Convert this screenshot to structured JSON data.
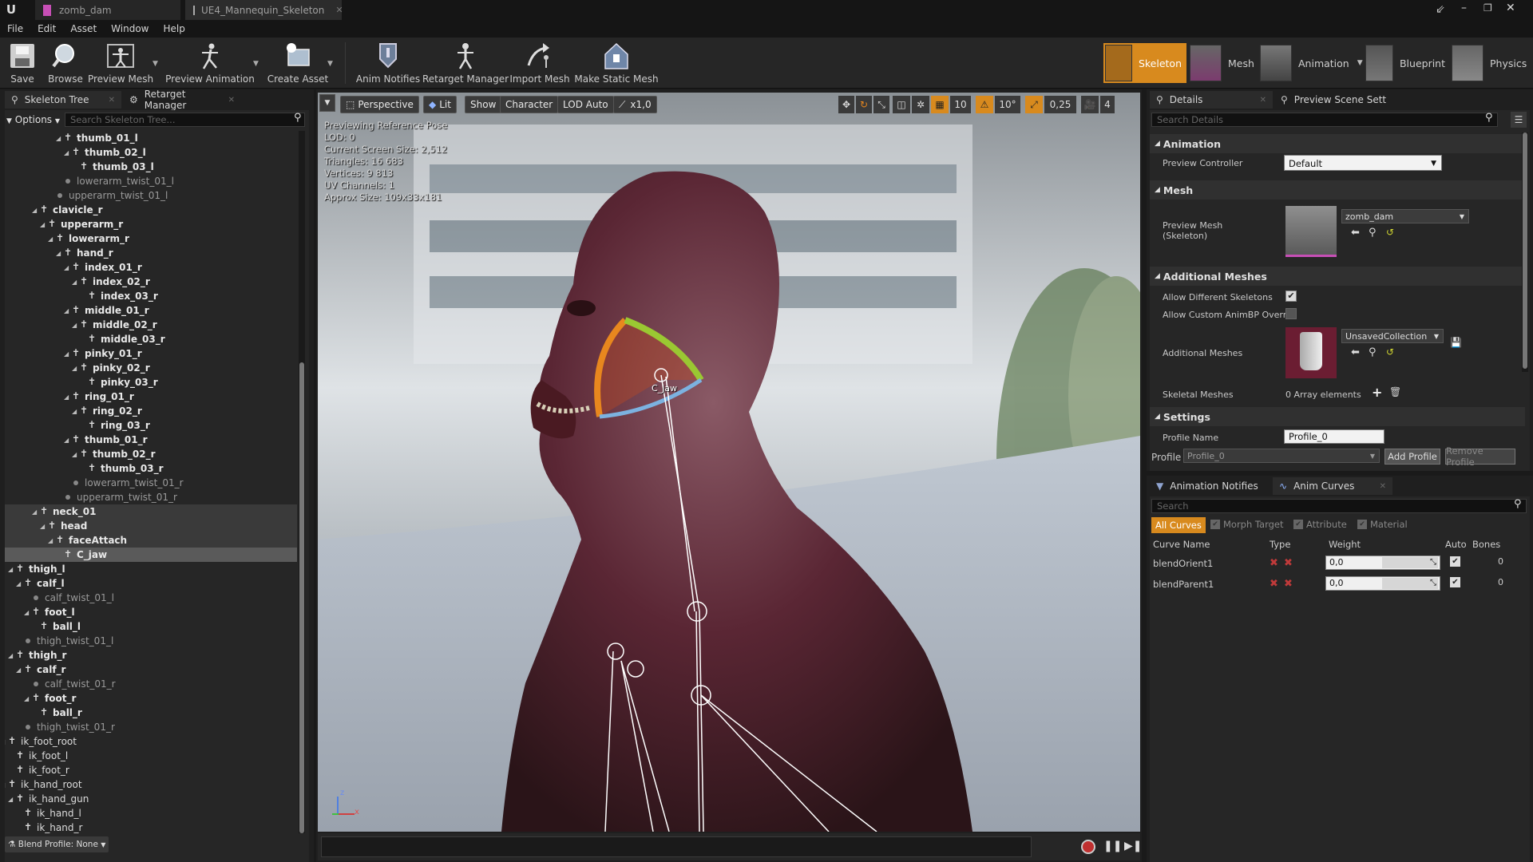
{
  "window": {
    "tabs": [
      {
        "label": "zomb_dam"
      },
      {
        "label": "UE4_Mannequin_Skeleton"
      }
    ]
  },
  "menu": [
    "File",
    "Edit",
    "Asset",
    "Window",
    "Help"
  ],
  "toolbar": {
    "buttons": [
      {
        "label": "Save"
      },
      {
        "label": "Browse"
      },
      {
        "label": "Preview Mesh"
      },
      {
        "label": "Preview Animation"
      },
      {
        "label": "Create Asset"
      },
      {
        "label": "Anim Notifies"
      },
      {
        "label": "Retarget Manager"
      },
      {
        "label": "Import Mesh"
      },
      {
        "label": "Make Static Mesh"
      }
    ],
    "modes": [
      {
        "label": "Skeleton",
        "active": true
      },
      {
        "label": "Mesh"
      },
      {
        "label": "Animation"
      },
      {
        "label": "Blueprint"
      },
      {
        "label": "Physics"
      }
    ]
  },
  "left_panel": {
    "tabs": [
      "Skeleton Tree",
      "Retarget Manager"
    ],
    "options_label": "Options",
    "search_placeholder": "Search Skeleton Tree...",
    "blend_profile": "Blend Profile: None",
    "tree": [
      {
        "name": "thumb_01_l",
        "depth": 9,
        "type": "bone",
        "exp": true
      },
      {
        "name": "thumb_02_l",
        "depth": 10,
        "type": "bone",
        "exp": true
      },
      {
        "name": "thumb_03_l",
        "depth": 11,
        "type": "bone"
      },
      {
        "name": "lowerarm_twist_01_l",
        "depth": 9,
        "type": "virtual"
      },
      {
        "name": "upperarm_twist_01_l",
        "depth": 8,
        "type": "virtual"
      },
      {
        "name": "clavicle_r",
        "depth": 6,
        "type": "bone",
        "exp": true
      },
      {
        "name": "upperarm_r",
        "depth": 7,
        "type": "bone",
        "exp": true
      },
      {
        "name": "lowerarm_r",
        "depth": 8,
        "type": "bone",
        "exp": true
      },
      {
        "name": "hand_r",
        "depth": 9,
        "type": "bone",
        "exp": true
      },
      {
        "name": "index_01_r",
        "depth": 10,
        "type": "bone",
        "exp": true
      },
      {
        "name": "index_02_r",
        "depth": 11,
        "type": "bone",
        "exp": true
      },
      {
        "name": "index_03_r",
        "depth": 12,
        "type": "bone"
      },
      {
        "name": "middle_01_r",
        "depth": 10,
        "type": "bone",
        "exp": true
      },
      {
        "name": "middle_02_r",
        "depth": 11,
        "type": "bone",
        "exp": true
      },
      {
        "name": "middle_03_r",
        "depth": 12,
        "type": "bone"
      },
      {
        "name": "pinky_01_r",
        "depth": 10,
        "type": "bone",
        "exp": true
      },
      {
        "name": "pinky_02_r",
        "depth": 11,
        "type": "bone",
        "exp": true
      },
      {
        "name": "pinky_03_r",
        "depth": 12,
        "type": "bone"
      },
      {
        "name": "ring_01_r",
        "depth": 10,
        "type": "bone",
        "exp": true
      },
      {
        "name": "ring_02_r",
        "depth": 11,
        "type": "bone",
        "exp": true
      },
      {
        "name": "ring_03_r",
        "depth": 12,
        "type": "bone"
      },
      {
        "name": "thumb_01_r",
        "depth": 10,
        "type": "bone",
        "exp": true
      },
      {
        "name": "thumb_02_r",
        "depth": 11,
        "type": "bone",
        "exp": true
      },
      {
        "name": "thumb_03_r",
        "depth": 12,
        "type": "bone"
      },
      {
        "name": "lowerarm_twist_01_r",
        "depth": 10,
        "type": "virtual"
      },
      {
        "name": "upperarm_twist_01_r",
        "depth": 9,
        "type": "virtual"
      },
      {
        "name": "neck_01",
        "depth": 6,
        "type": "bone",
        "exp": true,
        "hl": true
      },
      {
        "name": "head",
        "depth": 7,
        "type": "bone",
        "exp": true,
        "hl": true
      },
      {
        "name": "faceAttach",
        "depth": 8,
        "type": "bone",
        "exp": true,
        "hl": true
      },
      {
        "name": "C_jaw",
        "depth": 9,
        "type": "bone",
        "sel": true
      },
      {
        "name": "thigh_l",
        "depth": 3,
        "type": "bone",
        "exp": true
      },
      {
        "name": "calf_l",
        "depth": 4,
        "type": "bone",
        "exp": true
      },
      {
        "name": "calf_twist_01_l",
        "depth": 5,
        "type": "virtual"
      },
      {
        "name": "foot_l",
        "depth": 5,
        "type": "bone",
        "exp": true
      },
      {
        "name": "ball_l",
        "depth": 6,
        "type": "bone"
      },
      {
        "name": "thigh_twist_01_l",
        "depth": 4,
        "type": "virtual"
      },
      {
        "name": "thigh_r",
        "depth": 3,
        "type": "bone",
        "exp": true
      },
      {
        "name": "calf_r",
        "depth": 4,
        "type": "bone",
        "exp": true
      },
      {
        "name": "calf_twist_01_r",
        "depth": 5,
        "type": "virtual"
      },
      {
        "name": "foot_r",
        "depth": 5,
        "type": "bone",
        "exp": true
      },
      {
        "name": "ball_r",
        "depth": 6,
        "type": "bone"
      },
      {
        "name": "thigh_twist_01_r",
        "depth": 4,
        "type": "virtual"
      },
      {
        "name": "ik_foot_root",
        "depth": 2,
        "type": "bone",
        "exp": true,
        "plain": true
      },
      {
        "name": "ik_foot_l",
        "depth": 3,
        "type": "bone",
        "plain": true
      },
      {
        "name": "ik_foot_r",
        "depth": 3,
        "type": "bone",
        "plain": true
      },
      {
        "name": "ik_hand_root",
        "depth": 2,
        "type": "bone",
        "exp": true,
        "plain": true
      },
      {
        "name": "ik_hand_gun",
        "depth": 3,
        "type": "bone",
        "exp": true,
        "plain": true
      },
      {
        "name": "ik_hand_l",
        "depth": 4,
        "type": "bone",
        "plain": true
      },
      {
        "name": "ik_hand_r",
        "depth": 4,
        "type": "bone",
        "plain": true
      }
    ]
  },
  "viewport": {
    "buttons": [
      "Perspective",
      "Lit",
      "Show",
      "Character",
      "LOD Auto",
      "x1,0"
    ],
    "right_controls": {
      "grid": "10",
      "angle": "10°",
      "scale": "0,25",
      "speed": "4"
    },
    "stats": [
      "Previewing Reference Pose",
      "LOD: 0",
      "Current Screen Size: 2,512",
      "Triangles: 16 683",
      "Vertices: 9 813",
      "UV Channels: 1",
      "Approx Size: 109x33x181"
    ],
    "bone_label": "C_jaw",
    "axis": {
      "x": "x",
      "z": "z"
    }
  },
  "details": {
    "tabs": [
      "Details",
      "Preview Scene Sett"
    ],
    "search_placeholder": "Search Details",
    "sections": {
      "animation": "Animation",
      "mesh": "Mesh",
      "additional": "Additional Meshes",
      "settings": "Settings"
    },
    "preview_controller": {
      "label": "Preview Controller",
      "value": "Default"
    },
    "preview_mesh": {
      "label": "Preview Mesh\n(Skeleton)",
      "value": "zomb_dam"
    },
    "allow_diff": {
      "label": "Allow Different Skeletons",
      "checked": true
    },
    "allow_custom": {
      "label": "Allow Custom AnimBP Overr",
      "checked": false
    },
    "additional_meshes": {
      "label": "Additional Meshes",
      "value": "UnsavedCollection"
    },
    "skeletal_meshes": {
      "label": "Skeletal Meshes",
      "value": "0 Array elements"
    },
    "profile_name": {
      "label": "Profile Name",
      "value": "Profile_0"
    },
    "profile": {
      "label": "Profile",
      "value": "Profile_0",
      "add": "Add Profile",
      "remove": "Remove Profile"
    }
  },
  "curves": {
    "tabs": [
      "Animation Notifies",
      "Anim Curves"
    ],
    "search_placeholder": "Search",
    "filters": [
      {
        "label": "All Curves",
        "active": true
      },
      {
        "label": "Morph Target"
      },
      {
        "label": "Attribute"
      },
      {
        "label": "Material"
      }
    ],
    "columns": [
      "Curve Name",
      "Type",
      "Weight",
      "Auto",
      "Bones"
    ],
    "rows": [
      {
        "name": "blendOrient1",
        "weight": "0,0",
        "bones": "0"
      },
      {
        "name": "blendParent1",
        "weight": "0,0",
        "bones": "0"
      }
    ]
  }
}
